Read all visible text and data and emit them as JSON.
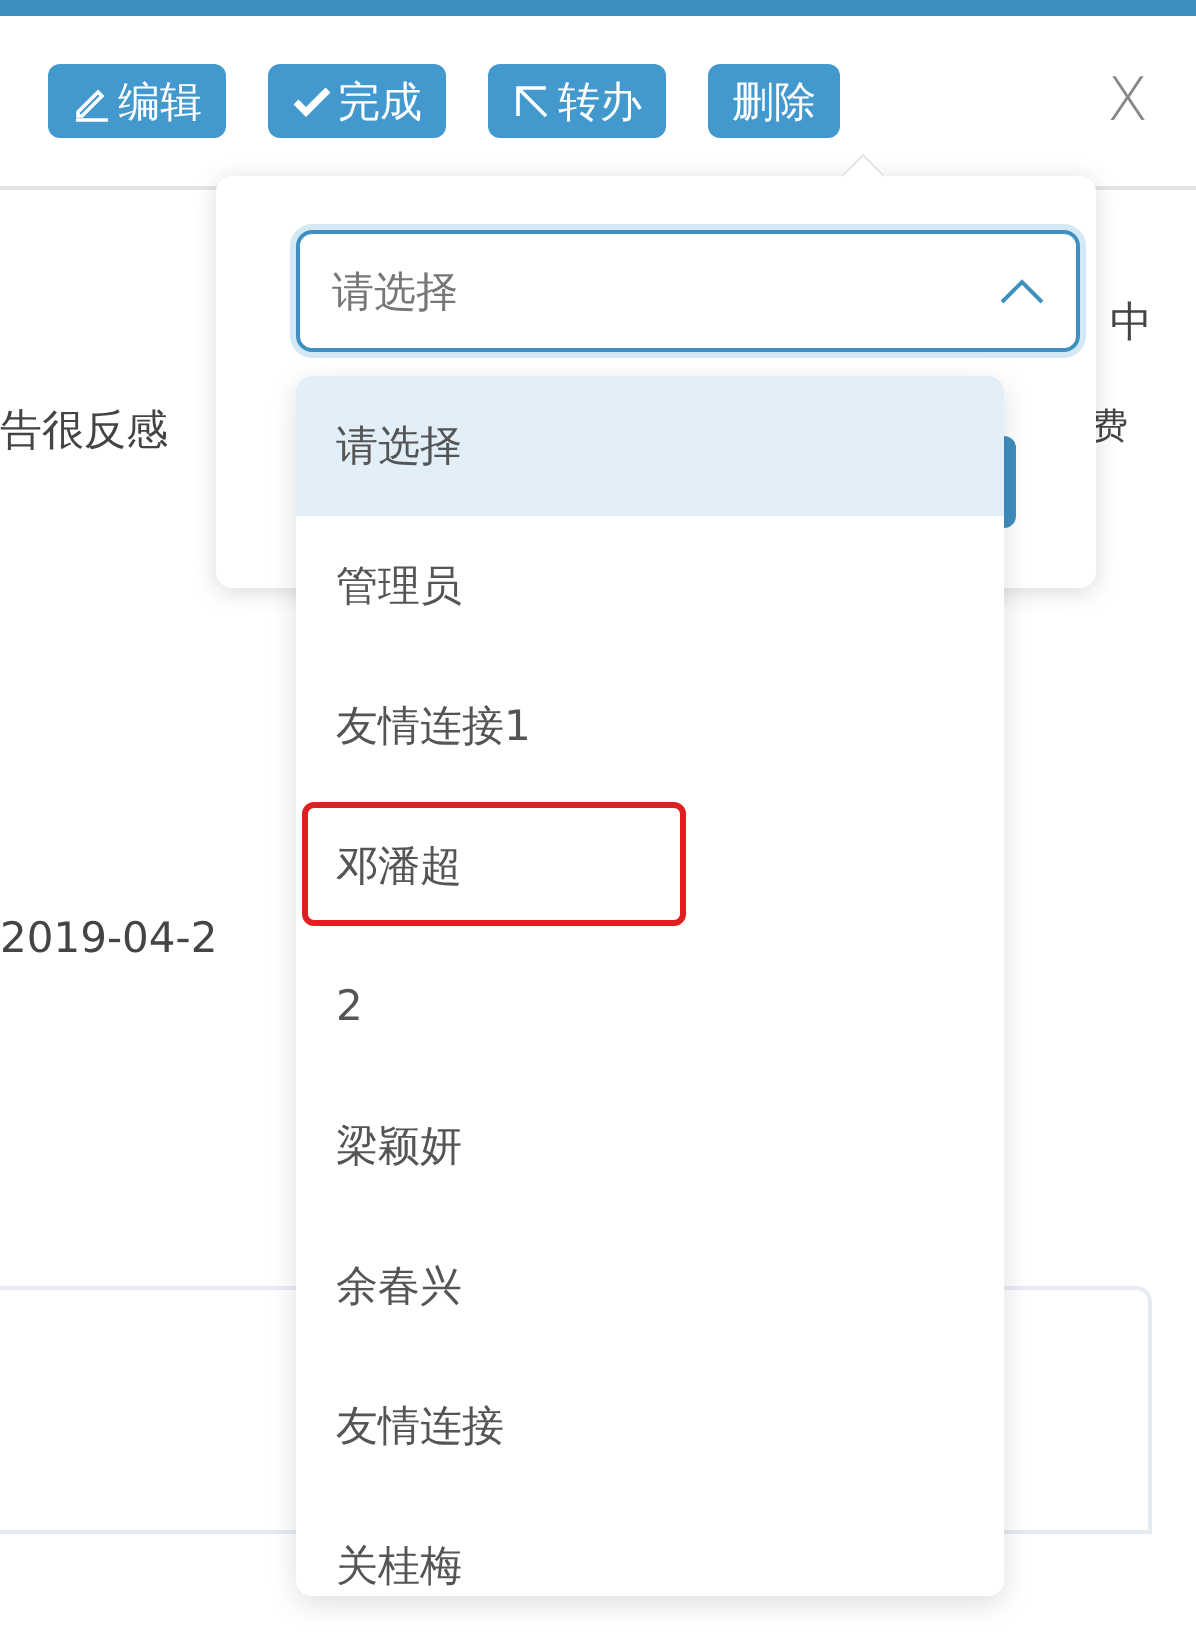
{
  "toolbar": {
    "buttons": [
      {
        "kind": "edit",
        "label": "编辑"
      },
      {
        "kind": "done",
        "label": "完成"
      },
      {
        "kind": "transfer",
        "label": "转办"
      },
      {
        "kind": "delete",
        "label": "删除"
      }
    ],
    "close": "X"
  },
  "background": {
    "right_top": "中",
    "left_middle": "告很反感",
    "right_middle": "费",
    "date": "2019-04-2"
  },
  "transfer_popover": {
    "select": {
      "placeholder": "请选择",
      "expanded": true
    },
    "options": [
      {
        "label": "请选择",
        "selected": true,
        "highlighted": false
      },
      {
        "label": "管理员",
        "selected": false,
        "highlighted": false
      },
      {
        "label": "友情连接1",
        "selected": false,
        "highlighted": false
      },
      {
        "label": "邓潘超",
        "selected": false,
        "highlighted": true
      },
      {
        "label": "2",
        "selected": false,
        "highlighted": false
      },
      {
        "label": "梁颖妍",
        "selected": false,
        "highlighted": false
      },
      {
        "label": "余春兴",
        "selected": false,
        "highlighted": false
      },
      {
        "label": "友情连接",
        "selected": false,
        "highlighted": false
      },
      {
        "label": "关桂梅",
        "selected": false,
        "highlighted": false
      }
    ]
  }
}
